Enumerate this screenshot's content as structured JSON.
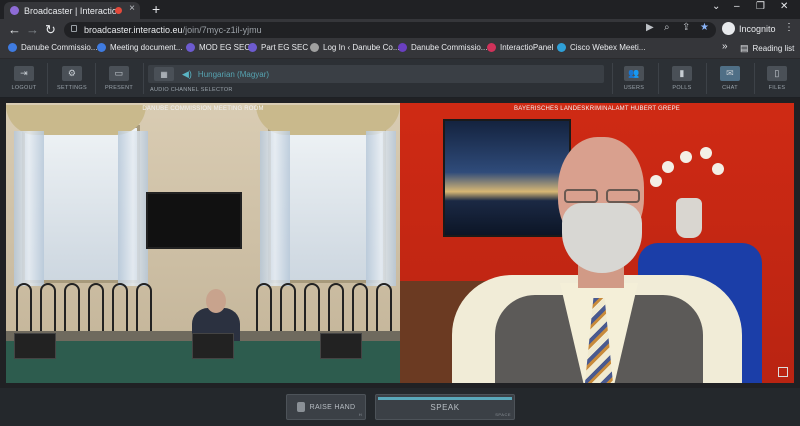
{
  "browser": {
    "tab_title": "Broadcaster | Interactio",
    "new_tab": "+",
    "tab_close": "×",
    "url_host": "broadcaster.interactio.eu",
    "url_path": "/join/7myc-z1il-yjmu",
    "profile_label": "Incognito",
    "window_minimize": "–",
    "window_restore": "❐",
    "window_close": "✕",
    "bookmarks": [
      {
        "label": "Danube Commissio...",
        "color": "#3f7be0"
      },
      {
        "label": "Meeting document...",
        "color": "#3f7be0"
      },
      {
        "label": "MOD EG SEC",
        "color": "#6d5bd0"
      },
      {
        "label": "Part EG SEC",
        "color": "#6d5bd0"
      },
      {
        "label": "Log In ‹ Danube Co...",
        "color": "#a0a0a0"
      },
      {
        "label": "Danube Commissio...",
        "color": "#6a3fc0"
      },
      {
        "label": "InteractioPanel",
        "color": "#d0325a"
      },
      {
        "label": "Cisco Webex Meeti...",
        "color": "#2fa0d8"
      }
    ],
    "bookmarks_more": "»",
    "reading_list": "Reading list"
  },
  "toolbar": {
    "logout": "LOGOUT",
    "settings": "SETTINGS",
    "present": "PRESENT",
    "audio_channel_label": "AUDIO CHANNEL SELECTOR",
    "audio_channel_value": "Hungarian (Magyar)",
    "users": "USERS",
    "polls": "POLLS",
    "chat": "CHAT",
    "files": "FILES"
  },
  "feeds": {
    "left_label": "DANUBE COMMISSION MEETING ROOM",
    "right_label": "BAYERISCHES LANDESKRIMINALAMT HUBERT GREPE"
  },
  "controls": {
    "raise_hand": "RAISE HAND",
    "raise_hand_key": "H",
    "speak": "SPEAK",
    "speak_key": "SPACE"
  }
}
